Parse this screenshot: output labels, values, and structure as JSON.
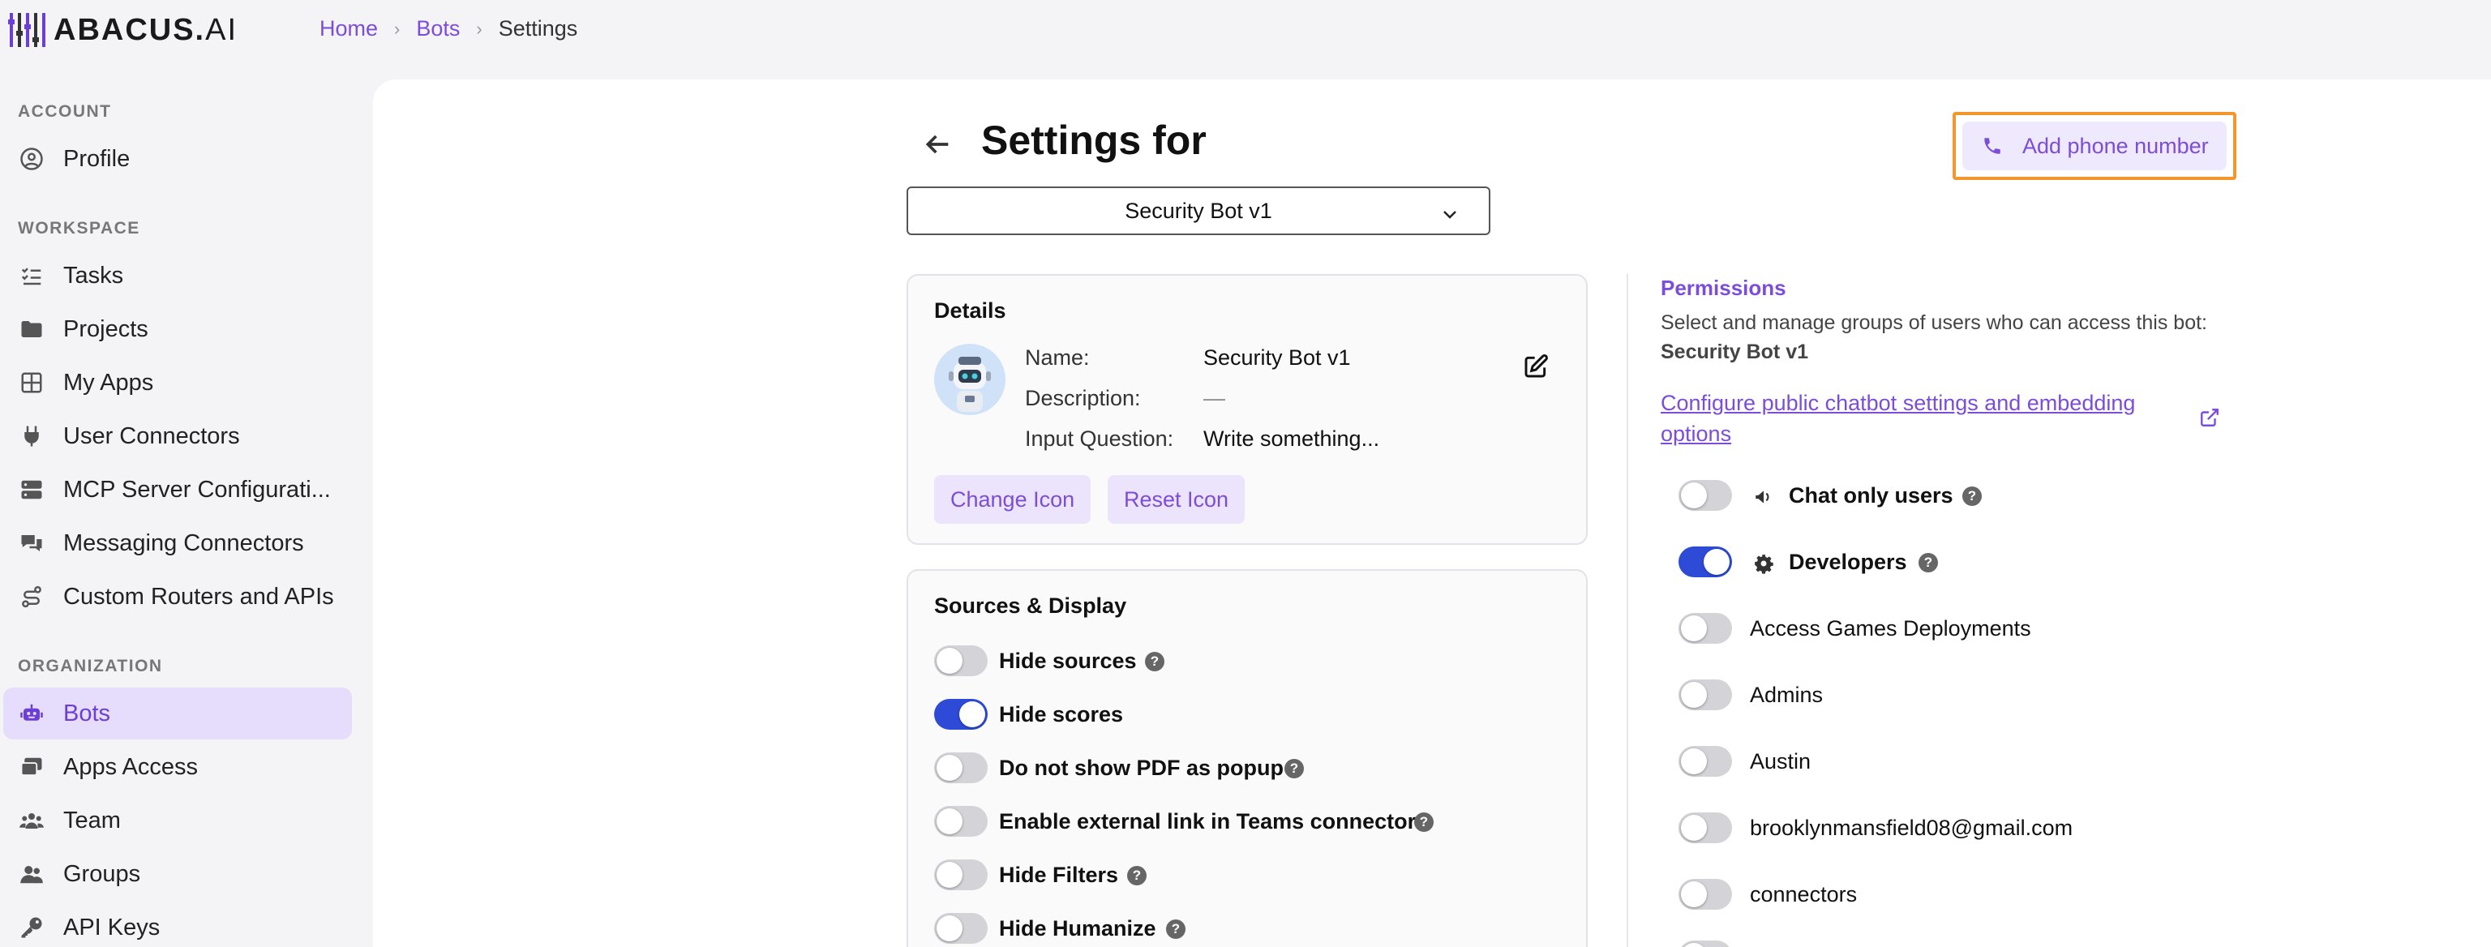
{
  "logo": {
    "bold": "ABACUS.",
    "light": "AI"
  },
  "breadcrumb": {
    "home": "Home",
    "bots": "Bots",
    "current": "Settings"
  },
  "sidebar": {
    "account_title": "ACCOUNT",
    "workspace_title": "WORKSPACE",
    "organization_title": "ORGANIZATION",
    "items": [
      {
        "label": "Profile",
        "icon": "user-circle-icon"
      },
      {
        "label": "Tasks",
        "icon": "list-check-icon"
      },
      {
        "label": "Projects",
        "icon": "folder-icon"
      },
      {
        "label": "My Apps",
        "icon": "grid-icon"
      },
      {
        "label": "User Connectors",
        "icon": "plug-icon"
      },
      {
        "label": "MCP Server Configurati...",
        "icon": "server-icon"
      },
      {
        "label": "Messaging Connectors",
        "icon": "chat-bubbles-icon"
      },
      {
        "label": "Custom Routers and APIs",
        "icon": "route-icon"
      },
      {
        "label": "Bots",
        "icon": "robot-icon"
      },
      {
        "label": "Apps Access",
        "icon": "apps-access-icon"
      },
      {
        "label": "Team",
        "icon": "team-icon"
      },
      {
        "label": "Groups",
        "icon": "groups-icon"
      },
      {
        "label": "API Keys",
        "icon": "key-icon"
      }
    ]
  },
  "header": {
    "title": "Settings for",
    "selected_bot": "Security Bot v1",
    "add_phone_label": "Add phone number"
  },
  "details": {
    "title": "Details",
    "name_label": "Name:",
    "name_value": "Security Bot v1",
    "description_label": "Description:",
    "description_value": "—",
    "input_label": "Input Question:",
    "input_value": "Write something...",
    "change_icon": "Change Icon",
    "reset_icon": "Reset Icon"
  },
  "sources": {
    "title": "Sources & Display",
    "toggles": [
      {
        "label": "Hide sources",
        "on": false,
        "help": true
      },
      {
        "label": "Hide scores",
        "on": true,
        "help": false
      },
      {
        "label": "Do not show PDF as popup",
        "on": false,
        "help": true
      },
      {
        "label": "Enable external link in Teams connector",
        "on": false,
        "help": true
      },
      {
        "label": "Hide Filters",
        "on": false,
        "help": true
      },
      {
        "label": "Hide Humanize",
        "on": false,
        "help": true
      }
    ]
  },
  "permissions": {
    "title": "Permissions",
    "description": "Select and manage groups of users who can access this bot:",
    "bot_name": "Security Bot v1",
    "link_text": "Configure public chatbot settings and embedding options",
    "groups": [
      {
        "label": "Chat only users",
        "on": false,
        "icon": "megaphone-icon",
        "bold": true,
        "help": true
      },
      {
        "label": "Developers",
        "on": true,
        "icon": "gear-icon",
        "bold": true,
        "help": true
      },
      {
        "label": "Access Games Deployments",
        "on": false
      },
      {
        "label": "Admins",
        "on": false
      },
      {
        "label": "Austin",
        "on": false
      },
      {
        "label": "brooklynmansfield08@gmail.com",
        "on": false
      },
      {
        "label": "connectors",
        "on": false
      }
    ]
  }
}
